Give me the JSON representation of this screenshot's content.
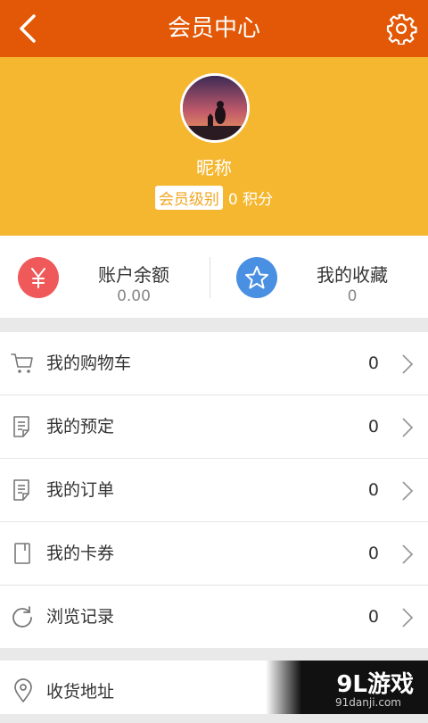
{
  "header": {
    "title": "会员中心"
  },
  "profile": {
    "nickname": "昵称",
    "level_badge": "会员级别",
    "points": "0 积分"
  },
  "stats": [
    {
      "label": "账户余额",
      "value": "0.00",
      "icon": "yuan-icon",
      "color": "#f0595a"
    },
    {
      "label": "我的收藏",
      "value": "0",
      "icon": "star-icon",
      "color": "#4a90e2"
    }
  ],
  "menu": [
    {
      "label": "我的购物车",
      "count": "0",
      "icon": "cart-icon"
    },
    {
      "label": "我的预定",
      "count": "0",
      "icon": "reservation-doc-icon"
    },
    {
      "label": "我的订单",
      "count": "0",
      "icon": "order-doc-icon"
    },
    {
      "label": "我的卡券",
      "count": "0",
      "icon": "card-coupon-icon"
    },
    {
      "label": "浏览记录",
      "count": "0",
      "icon": "history-refresh-icon"
    }
  ],
  "address": {
    "label": "收货地址",
    "icon": "location-pin-icon"
  },
  "watermark": {
    "main": "9L游戏",
    "sub": "91danji.com"
  },
  "colors": {
    "topbar": "#e25806",
    "profile_bg": "#f6b730",
    "page_bg": "#e9e9e9"
  }
}
